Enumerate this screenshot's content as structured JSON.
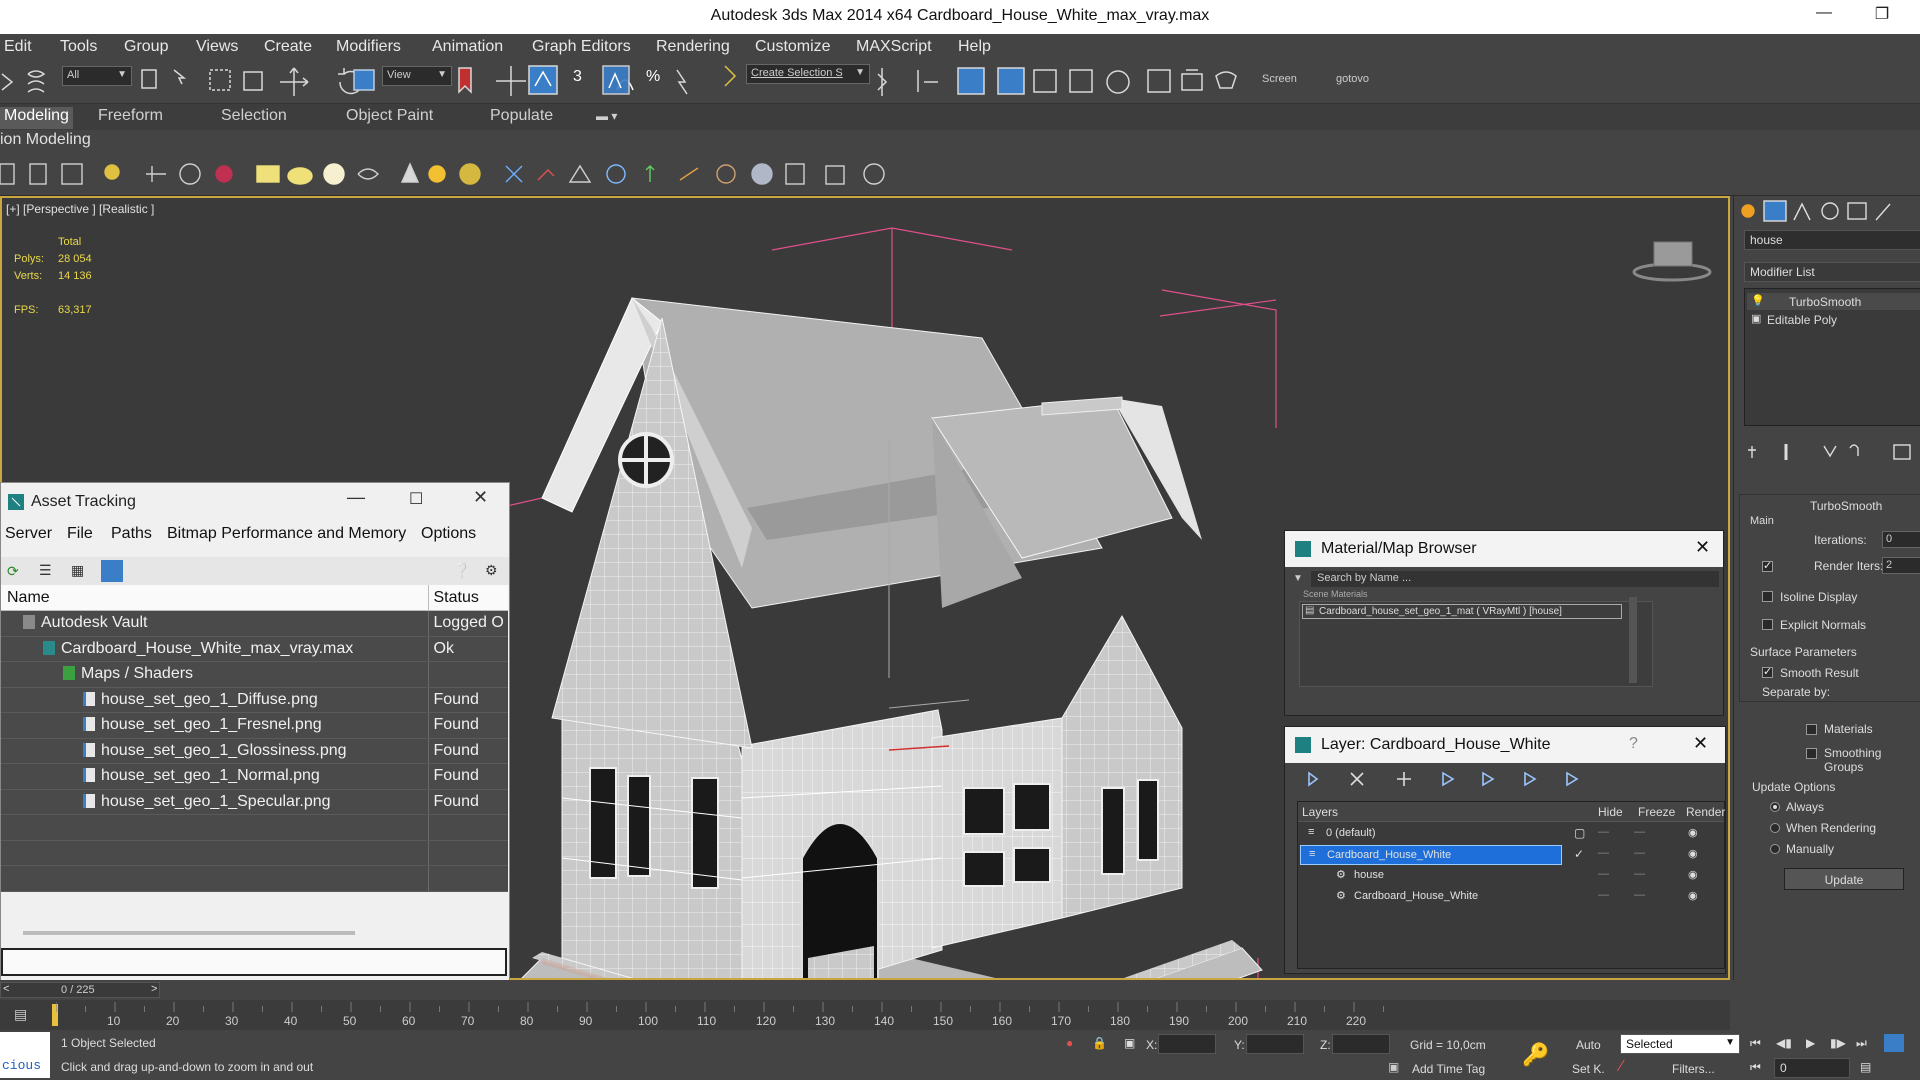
{
  "title": "Autodesk 3ds Max  2014 x64      Cardboard_House_White_max_vray.max",
  "menu": [
    "Edit",
    "Tools",
    "Group",
    "Views",
    "Create",
    "Modifiers",
    "Animation",
    "Graph Editors",
    "Rendering",
    "Customize",
    "MAXScript",
    "Help"
  ],
  "toolbar": {
    "filter": "All",
    "refcoord": "View",
    "selset_placeholder": "Create Selection S",
    "screen_label": "Screen",
    "gotovo_label": "gotovo",
    "snap3": "3",
    "snap_pct": "%"
  },
  "ribbon": {
    "tabs": [
      "Modeling",
      "Freeform",
      "Selection",
      "Object Paint",
      "Populate"
    ],
    "sub": "ion Modeling"
  },
  "viewport": {
    "label": "[+] [Perspective ] [Realistic ]",
    "total_label": "Total",
    "polys_label": "Polys:",
    "polys_value": "28 054",
    "verts_label": "Verts:",
    "verts_value": "14 136",
    "fps_label": "FPS:",
    "fps_value": "63,317"
  },
  "command_panel": {
    "object_name": "house",
    "modifier_list": "Modifier List",
    "stack": [
      "TurboSmooth",
      "Editable Poly"
    ],
    "rollout_title": "TurboSmooth",
    "main_label": "Main",
    "iterations_label": "Iterations:",
    "iterations_value": "0",
    "render_iters_label": "Render Iters:",
    "render_iters_value": "2",
    "isoline": "Isoline Display",
    "explicit": "Explicit Normals",
    "surface_params": "Surface Parameters",
    "smooth_result": "Smooth Result",
    "separate_by": "Separate by:",
    "materials": "Materials",
    "smoothing_groups": "Smoothing Groups",
    "update_options": "Update Options",
    "always": "Always",
    "when_rendering": "When Rendering",
    "manually": "Manually",
    "update_btn": "Update"
  },
  "asset_tracking": {
    "title": "Asset Tracking",
    "menu": [
      "Server",
      "File",
      "Paths",
      "Bitmap Performance and Memory",
      "Options"
    ],
    "col_name": "Name",
    "col_status": "Status",
    "rows": [
      {
        "name": "Autodesk Vault",
        "status": "Logged O",
        "indent": 0,
        "icon": "vault-icon"
      },
      {
        "name": "Cardboard_House_White_max_vray.max",
        "status": "Ok",
        "indent": 1,
        "icon": "max-file-icon"
      },
      {
        "name": "Maps / Shaders",
        "status": "",
        "indent": 2,
        "icon": "maps-folder-icon"
      },
      {
        "name": "house_set_geo_1_Diffuse.png",
        "status": "Found",
        "indent": 3,
        "icon": "image-file-icon"
      },
      {
        "name": "house_set_geo_1_Fresnel.png",
        "status": "Found",
        "indent": 3,
        "icon": "image-file-icon"
      },
      {
        "name": "house_set_geo_1_Glossiness.png",
        "status": "Found",
        "indent": 3,
        "icon": "image-file-icon"
      },
      {
        "name": "house_set_geo_1_Normal.png",
        "status": "Found",
        "indent": 3,
        "icon": "image-file-icon"
      },
      {
        "name": "house_set_geo_1_Specular.png",
        "status": "Found",
        "indent": 3,
        "icon": "image-file-icon"
      },
      {
        "name": "",
        "status": "",
        "indent": 0,
        "icon": ""
      },
      {
        "name": "",
        "status": "",
        "indent": 0,
        "icon": ""
      },
      {
        "name": "",
        "status": "",
        "indent": 0,
        "icon": ""
      }
    ]
  },
  "material_browser": {
    "title": "Material/Map Browser",
    "search_placeholder": "Search by Name ...",
    "group": "Scene Materials",
    "item": "Cardboard_house_set_geo_1_mat ( VRayMtl ) [house]"
  },
  "layer_window": {
    "title": "Layer: Cardboard_House_White",
    "help": "?",
    "col_layers": "Layers",
    "col_hide": "Hide",
    "col_freeze": "Freeze",
    "col_render": "Render",
    "rows": [
      {
        "name": "0 (default)",
        "selected": false
      },
      {
        "name": "Cardboard_House_White",
        "selected": true
      },
      {
        "name": "house",
        "selected": false
      },
      {
        "name": "Cardboard_House_White",
        "selected": false
      }
    ]
  },
  "timeline": {
    "frame": "0 / 225",
    "ticks": [
      "10",
      "20",
      "30",
      "40",
      "50",
      "60",
      "70",
      "80",
      "90",
      "100",
      "110",
      "120",
      "130",
      "140",
      "150",
      "160",
      "170",
      "180",
      "190",
      "200",
      "210",
      "220"
    ]
  },
  "status": {
    "selected": "1 Object Selected",
    "prompt": "Click and drag up-and-down to zoom in and out",
    "script_label": "cious",
    "x_label": "X:",
    "y_label": "Y:",
    "z_label": "Z:",
    "grid": "Grid = 10,0cm",
    "auto": "Auto",
    "setk": "Set K.",
    "selected_dd": "Selected",
    "filters": "Filters...",
    "add_time_tag": "Add Time Tag",
    "frame_field": "0"
  },
  "colors": {
    "bg": "#444444",
    "viewport_border": "#c9a640",
    "stats": "#e8d84a",
    "selection_blue": "#1e6fd9",
    "bbox_pink": "#e0508a"
  }
}
